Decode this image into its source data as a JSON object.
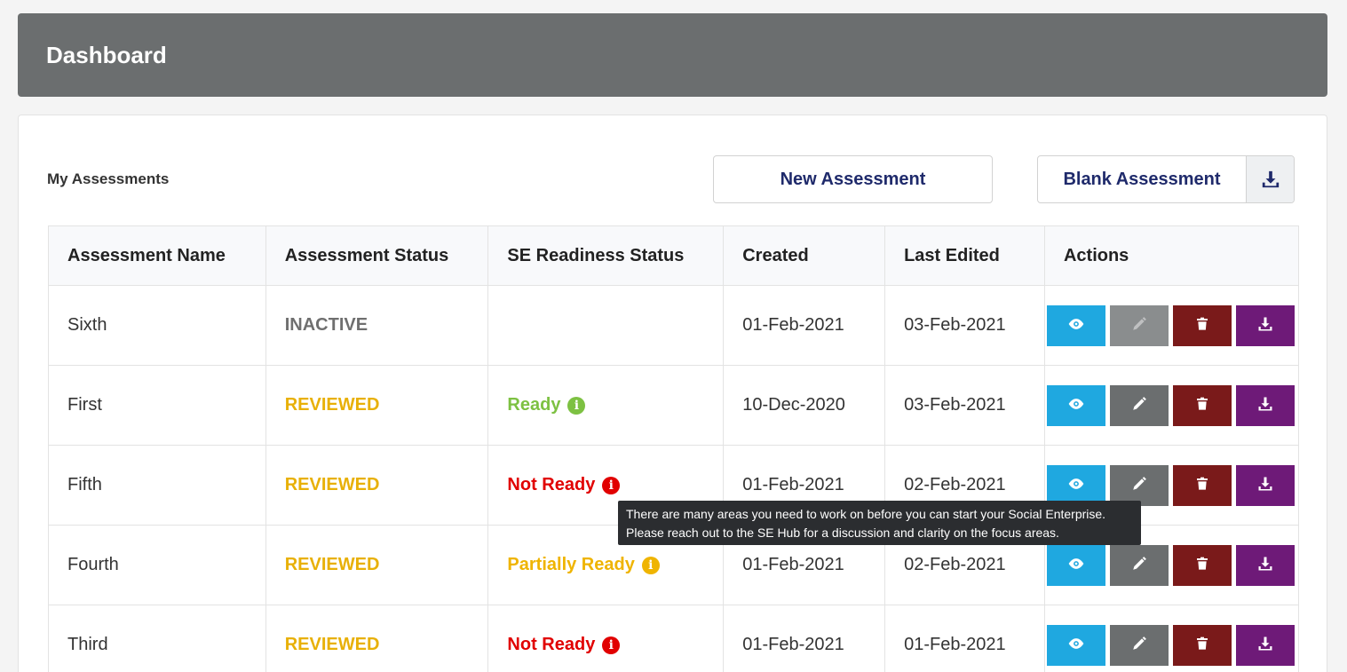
{
  "header": {
    "title": "Dashboard"
  },
  "section": {
    "title": "My Assessments",
    "new_button": "New Assessment",
    "blank_button": "Blank Assessment",
    "blank_icon": "download-icon"
  },
  "table": {
    "columns": [
      "Assessment Name",
      "Assessment Status",
      "SE Readiness Status",
      "Created",
      "Last Edited",
      "Actions"
    ],
    "rows": [
      {
        "name": "Sixth",
        "status": "INACTIVE",
        "readiness": "",
        "created": "01-Feb-2021",
        "edited": "03-Feb-2021"
      },
      {
        "name": "First",
        "status": "REVIEWED",
        "readiness": "Ready",
        "created": "10-Dec-2020",
        "edited": "03-Feb-2021"
      },
      {
        "name": "Fifth",
        "status": "REVIEWED",
        "readiness": "Not Ready",
        "created": "01-Feb-2021",
        "edited": "02-Feb-2021"
      },
      {
        "name": "Fourth",
        "status": "REVIEWED",
        "readiness": "Partially Ready",
        "created": "01-Feb-2021",
        "edited": "02-Feb-2021"
      },
      {
        "name": "Third",
        "status": "REVIEWED",
        "readiness": "Not Ready",
        "created": "01-Feb-2021",
        "edited": "01-Feb-2021"
      }
    ]
  },
  "tooltip": {
    "line1": "There are many areas you need to work on before you can start your Social Enterprise.",
    "line2": "Please reach out to the SE Hub for a discussion and clarity on the focus areas."
  },
  "colors": {
    "header_bg": "#6b6e6f",
    "view": "#1fa8e0",
    "edit": "#6b6e6f",
    "delete": "#7a1a1a",
    "download": "#6e1a78",
    "reviewed": "#e8b007",
    "ready": "#7dc142",
    "not_ready": "#e10000",
    "partial": "#efb400"
  },
  "icons": {
    "view": "eye-icon",
    "edit": "pencil-icon",
    "delete": "trash-icon",
    "download": "download-icon",
    "info": "info-icon"
  }
}
